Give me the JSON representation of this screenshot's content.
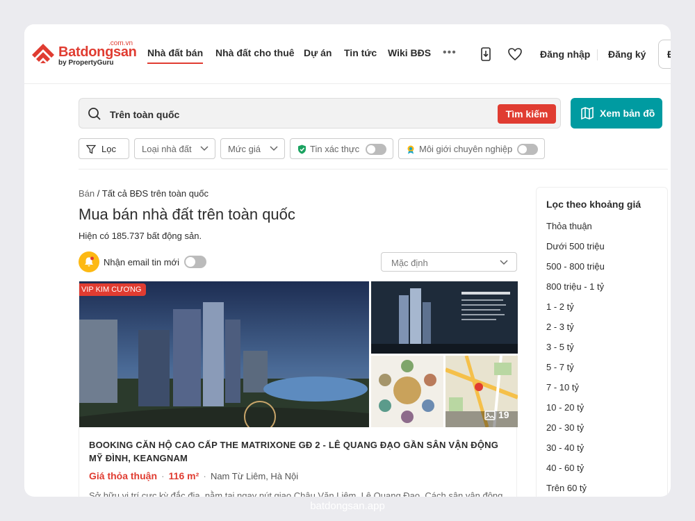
{
  "logo": {
    "domain": ".com.vn",
    "name": "Batdongsan",
    "sub": "by PropertyGuru"
  },
  "nav": {
    "items": [
      "Nhà đất bán",
      "Nhà đất cho thuê",
      "Dự án",
      "Tin tức",
      "Wiki BĐS"
    ],
    "more": "•••"
  },
  "header": {
    "login": "Đăng nhập",
    "register": "Đăng ký",
    "post_label": "Đ"
  },
  "search": {
    "value": "Trên toàn quốc",
    "button": "Tìm kiếm",
    "map_button": "Xem bản đồ"
  },
  "filters": {
    "filter": "Lọc",
    "type": "Loại nhà đất",
    "price": "Mức giá",
    "verified": "Tin xác thực",
    "pro_agent": "Môi giới chuyên nghiệp"
  },
  "breadcrumb": {
    "first": "Bán",
    "sep": " / ",
    "second": "Tất cả BĐS trên toàn quốc"
  },
  "page": {
    "title": "Mua bán nhà đất trên toàn quốc",
    "count": "Hiện có 185.737 bất động sản.",
    "email_label": "Nhận email tin mới",
    "sort": "Mặc định"
  },
  "listing": {
    "badge": "VIP KIM CƯƠNG",
    "photo_count": "19",
    "title": "BOOKING CĂN HỘ CAO CẤP THE MATRIXONE GĐ 2 - LÊ QUANG ĐẠO GẦN SÂN VẬN ĐỘNG MỸ ĐÌNH, KEANGNAM",
    "price": "Giá thỏa thuận",
    "area": "116 m²",
    "sep": "·",
    "location": "Nam Từ Liêm, Hà Nội",
    "description": "Sở hữu vị trí cực kỳ đắc địa, nằm tại ngay nút giao Châu Văn Liêm, Lê Quang Đạo. Cách sân vận động"
  },
  "sidebar": {
    "title": "Lọc theo khoảng giá",
    "items": [
      "Thỏa thuận",
      "Dưới 500 triệu",
      "500 - 800 triệu",
      "800 triệu - 1 tỷ",
      "1 - 2 tỷ",
      "2 - 3 tỷ",
      "3 - 5 tỷ",
      "5 - 7 tỷ",
      "7 - 10 tỷ",
      "10 - 20 tỷ",
      "20 - 30 tỷ",
      "30 - 40 tỷ",
      "40 - 60 tỷ",
      "Trên 60 tỷ"
    ]
  },
  "footer": {
    "domain": "batdongsan.app"
  },
  "colors": {
    "brand_red": "#e03c31",
    "teal": "#009ba1",
    "bell_yellow": "#fdb913"
  },
  "icons": [
    "logo-icon",
    "download-app-icon",
    "heart-icon",
    "search-icon",
    "map-icon",
    "filter-icon",
    "chevron-down-icon",
    "verified-shield-icon",
    "pro-agent-badge-icon",
    "bell-icon",
    "photo-icon"
  ]
}
